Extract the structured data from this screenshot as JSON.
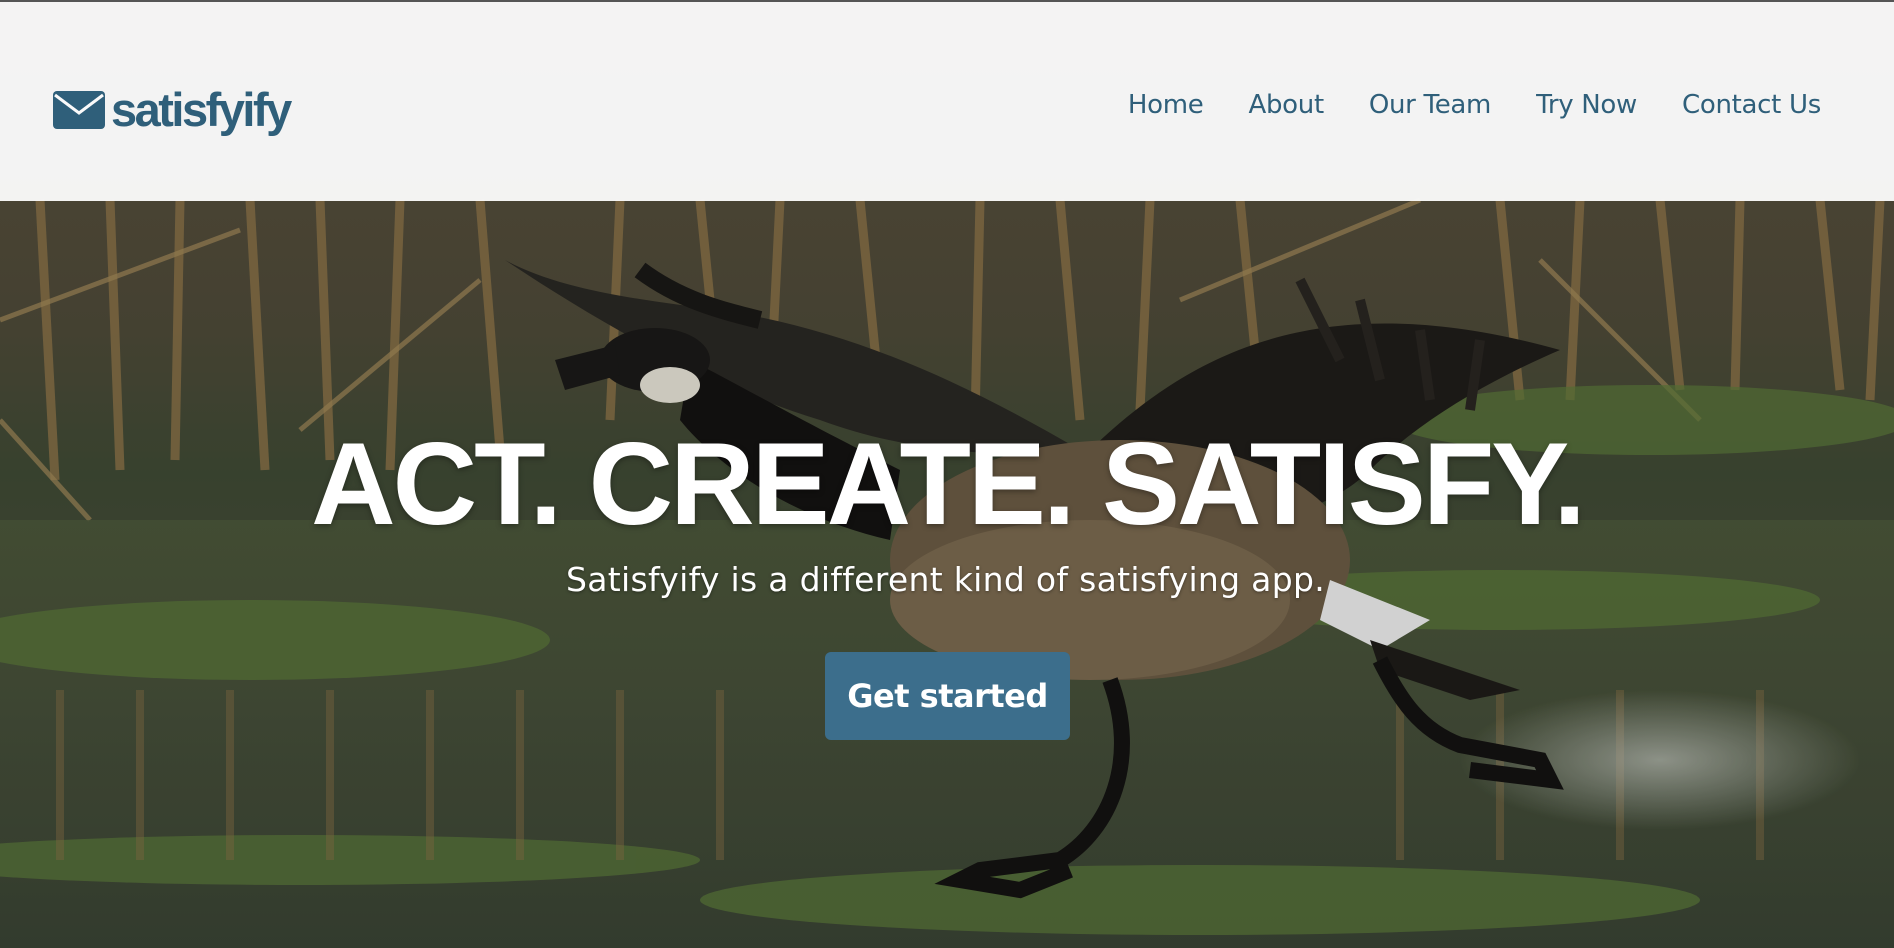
{
  "header": {
    "brand": {
      "name": "satisfyify",
      "icon": "envelope-icon"
    },
    "nav": [
      {
        "label": "Home"
      },
      {
        "label": "About"
      },
      {
        "label": "Our Team"
      },
      {
        "label": "Try Now"
      },
      {
        "label": "Contact Us"
      }
    ]
  },
  "hero": {
    "headline": "ACT. CREATE. SATISFY.",
    "subheadline": "Satisfyify is a different kind of satisfying app.",
    "cta_label": "Get started",
    "background": "canada-goose-running-on-water-photo"
  },
  "colors": {
    "brand": "#2f5f7a",
    "button": "#3c6e8c",
    "header_bg": "#fafafa",
    "hero_text": "#ffffff"
  }
}
